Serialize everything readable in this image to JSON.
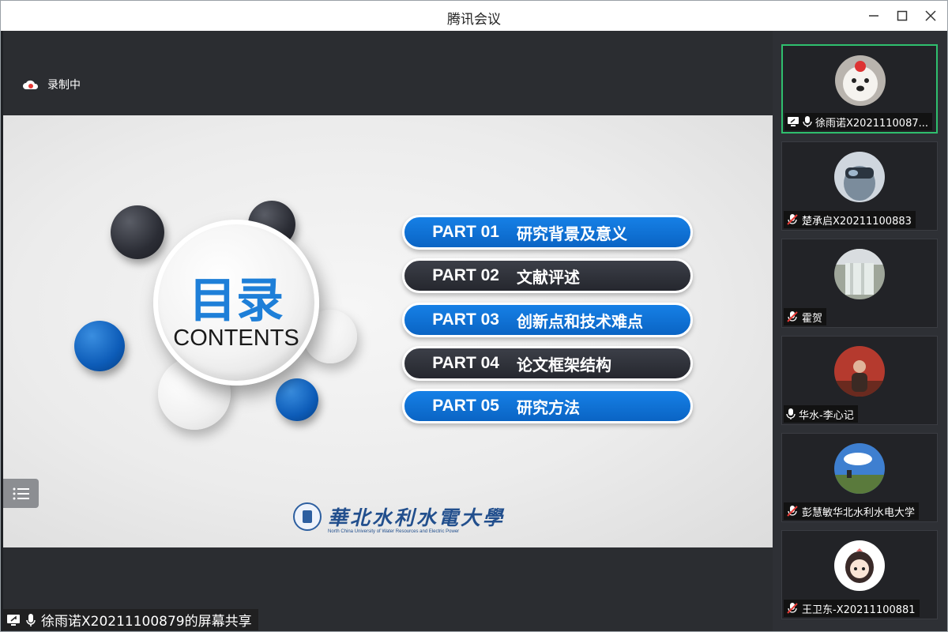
{
  "window": {
    "title": "腾讯会议"
  },
  "recording": {
    "label": "录制中"
  },
  "slide": {
    "title": "目录",
    "subtitle": "CONTENTS",
    "parts": [
      {
        "num": "PART 01",
        "text": "研究背景及意义",
        "style": "blue"
      },
      {
        "num": "PART 02",
        "text": "文献评述",
        "style": "dark"
      },
      {
        "num": "PART 03",
        "text": "创新点和技术难点",
        "style": "blue"
      },
      {
        "num": "PART 04",
        "text": "论文框架结构",
        "style": "dark"
      },
      {
        "num": "PART 05",
        "text": "研究方法",
        "style": "blue"
      }
    ],
    "logo_name": "華北水利水電大學",
    "logo_en": "North China University of Water Resources and Electric Power"
  },
  "share_bar": {
    "label": "徐雨诺X20211100879的屏幕共享"
  },
  "participants": [
    {
      "name": "徐雨诺X2021110087...",
      "mic": "on",
      "sharing": true,
      "active": true,
      "avatar": "dog-avatar"
    },
    {
      "name": "楚承启X20211100883",
      "mic": "muted",
      "sharing": false,
      "active": false,
      "avatar": "helmet-avatar"
    },
    {
      "name": "霍贺",
      "mic": "muted",
      "sharing": false,
      "active": false,
      "avatar": "waterfall-avatar"
    },
    {
      "name": "华水-李心记",
      "mic": "on",
      "sharing": false,
      "active": false,
      "avatar": "person-avatar"
    },
    {
      "name": "彭慧敏华北水利水电大学",
      "mic": "muted",
      "sharing": false,
      "active": false,
      "avatar": "landscape-avatar"
    },
    {
      "name": "王卫东-X20211100881",
      "mic": "muted",
      "sharing": false,
      "active": false,
      "avatar": "cartoon-girl-avatar"
    }
  ]
}
